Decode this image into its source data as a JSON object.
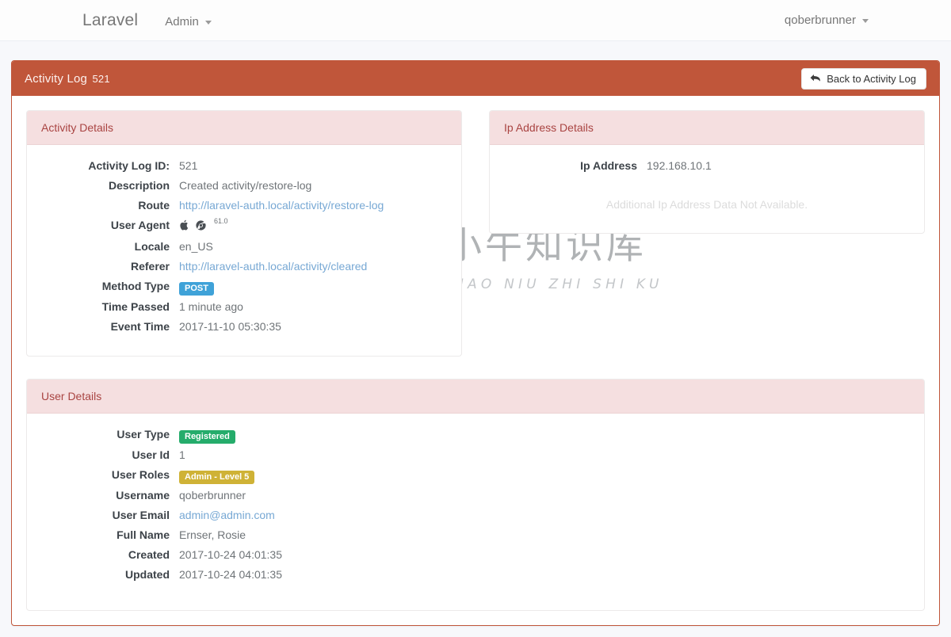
{
  "navbar": {
    "brand": "Laravel",
    "admin_label": "Admin",
    "user_label": "qoberbrunner"
  },
  "card": {
    "title": "Activity Log",
    "record_id": "521",
    "back_button_label": "Back to Activity Log",
    "back_icon": "reply-arrow-icon",
    "accent_color": "#c0563a"
  },
  "activity_panel": {
    "title": "Activity Details",
    "rows": [
      {
        "label": "Activity Log ID:",
        "value": "521",
        "kind": "text"
      },
      {
        "label": "Description",
        "value": "Created activity/restore-log",
        "kind": "text"
      },
      {
        "label": "Route",
        "value": "http://laravel-auth.local/activity/restore-log",
        "kind": "link"
      },
      {
        "label": "User Agent",
        "value": "",
        "kind": "useragent",
        "os_icon": "apple-icon",
        "browser_icon": "chrome-icon",
        "browser_version": "61.0"
      },
      {
        "label": "Locale",
        "value": "en_US",
        "kind": "text"
      },
      {
        "label": "Referer",
        "value": "http://laravel-auth.local/activity/cleared",
        "kind": "link"
      },
      {
        "label": "Method Type",
        "value": "POST",
        "kind": "badge",
        "badge_color": "#3fa2d8"
      },
      {
        "label": "Time Passed",
        "value": "1 minute ago",
        "kind": "text"
      },
      {
        "label": "Event Time",
        "value": "2017-11-10 05:30:35",
        "kind": "text"
      }
    ]
  },
  "ip_panel": {
    "title": "Ip Address Details",
    "rows": [
      {
        "label": "Ip Address",
        "value": "192.168.10.1",
        "kind": "text"
      }
    ],
    "empty_message": "Additional Ip Address Data Not Available."
  },
  "user_panel": {
    "title": "User Details",
    "rows": [
      {
        "label": "User Type",
        "value": "Registered",
        "kind": "badge",
        "badge_color": "#25ac6b"
      },
      {
        "label": "User Id",
        "value": "1",
        "kind": "text"
      },
      {
        "label": "User Roles",
        "value": "Admin - Level 5",
        "kind": "badge",
        "badge_color": "#cfb236"
      },
      {
        "label": "Username",
        "value": "qoberbrunner",
        "kind": "text"
      },
      {
        "label": "User Email",
        "value": "admin@admin.com",
        "kind": "link"
      },
      {
        "label": "Full Name",
        "value": "Ernser, Rosie",
        "kind": "text"
      },
      {
        "label": "Created",
        "value": "2017-10-24 04:01:35",
        "kind": "text"
      },
      {
        "label": "Updated",
        "value": "2017-10-24 04:01:35",
        "kind": "text"
      }
    ]
  },
  "watermark": {
    "logo_icon": "ox-circle-logo-icon",
    "text": "小牛知识库",
    "subtext": "XIAO NIU ZHI SHI KU"
  }
}
